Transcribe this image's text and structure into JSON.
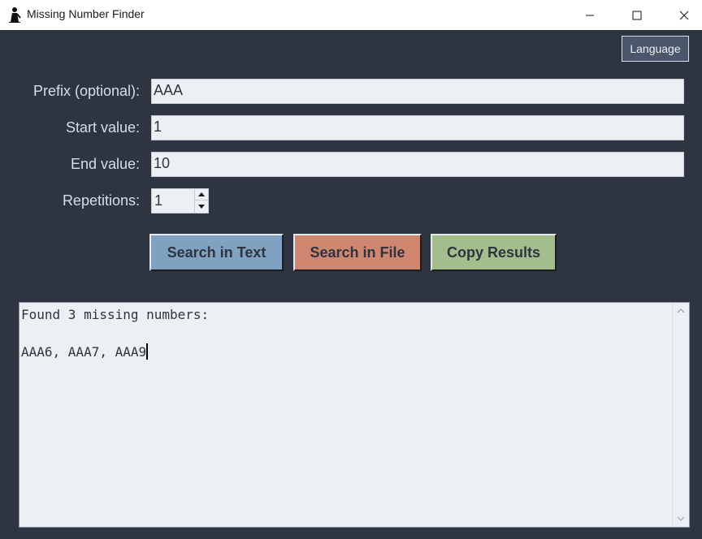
{
  "window": {
    "title": "Missing Number Finder",
    "icon": "app-icon",
    "controls": [
      "minimize-icon",
      "maximize-icon",
      "close-icon"
    ]
  },
  "language_button": {
    "label": "Language"
  },
  "form": {
    "prefix": {
      "label": "Prefix (optional):",
      "value": "AAA"
    },
    "start": {
      "label": "Start value:",
      "value": "1"
    },
    "end": {
      "label": "End value:",
      "value": "10"
    },
    "repetitions": {
      "label": "Repetitions:",
      "value": "1"
    }
  },
  "buttons": {
    "search_text": {
      "label": "Search in Text",
      "color": "#81a1c1"
    },
    "search_file": {
      "label": "Search in File",
      "color": "#d08770"
    },
    "copy_results": {
      "label": "Copy Results",
      "color": "#a3be8c"
    }
  },
  "results": {
    "summary": "Found 3 missing numbers:",
    "items": "AAA6, AAA7, AAA9"
  },
  "colors": {
    "background": "#2e3440",
    "field": "#eceff4",
    "label": "#d8dee9"
  }
}
